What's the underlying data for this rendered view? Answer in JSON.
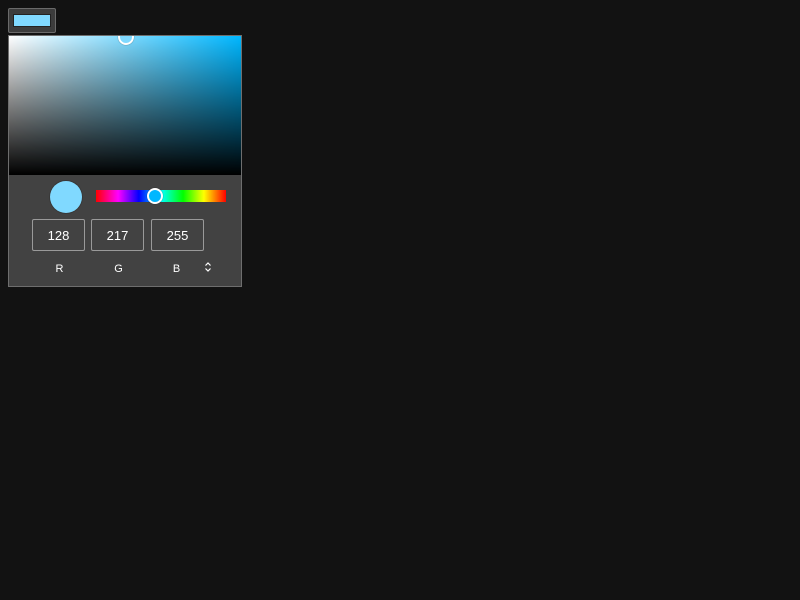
{
  "colors": {
    "selected": "#80d9ff",
    "hue": "#00b7ff",
    "page_background": "#121212",
    "panel_background": "#424242"
  },
  "picker": {
    "hue_degrees": 197,
    "saturation": 0.5,
    "value": 1.0,
    "mode": "RGB"
  },
  "channels": [
    {
      "label": "R",
      "value": "128"
    },
    {
      "label": "G",
      "value": "217"
    },
    {
      "label": "B",
      "value": "255"
    }
  ],
  "icons": {
    "mode_toggle": "unfold-icon"
  }
}
